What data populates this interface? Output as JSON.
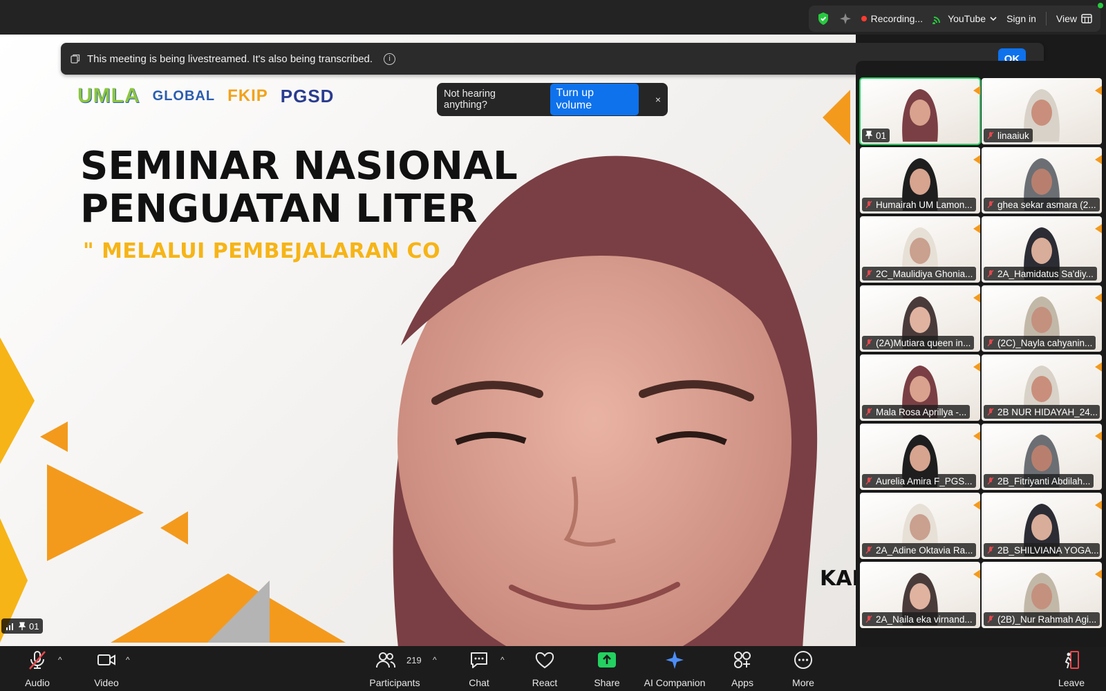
{
  "top_bar": {
    "recording_label": "Recording...",
    "stream_target": "YouTube",
    "sign_in_label": "Sign in",
    "view_label": "View"
  },
  "banner": {
    "text": "This meeting is being livestreamed. It's also being transcribed.",
    "ok_label": "OK"
  },
  "audio_toast": {
    "text": "Not hearing anything?",
    "button_label": "Turn up volume",
    "close_glyph": "×"
  },
  "slide": {
    "title": "SEMINAR NASIONAL\nPENGUATAN LITER",
    "subtitle": "\" MELALUI PEMBEJALARAN CO",
    "date_fragment": "KAN",
    "logos": [
      "UMLA",
      "GLOBAL",
      "FKIP",
      "PGSD"
    ]
  },
  "main_video": {
    "label": "01"
  },
  "gallery": {
    "tiles": [
      {
        "name": "01",
        "pinned": true,
        "active": true
      },
      {
        "name": "linaaiuk",
        "pinned": false,
        "active": false
      },
      {
        "name": "Humairah UM Lamon...",
        "pinned": false,
        "active": false
      },
      {
        "name": "ghea sekar asmara (2...",
        "pinned": false,
        "active": false
      },
      {
        "name": "2C_Maulidiya Ghonia...",
        "pinned": false,
        "active": false
      },
      {
        "name": "2A_Hamidatus Sa'diy...",
        "pinned": false,
        "active": false
      },
      {
        "name": "(2A)Mutiara queen in...",
        "pinned": false,
        "active": false
      },
      {
        "name": "(2C)_Nayla cahyanin...",
        "pinned": false,
        "active": false
      },
      {
        "name": "Mala Rosa Aprillya -...",
        "pinned": false,
        "active": false
      },
      {
        "name": "2B NUR HIDAYAH_24...",
        "pinned": false,
        "active": false
      },
      {
        "name": "Aurelia Amira F_PGS...",
        "pinned": false,
        "active": false
      },
      {
        "name": "2B_Fitriyanti Abdilah...",
        "pinned": false,
        "active": false
      },
      {
        "name": "2A_Adine Oktavia Ra...",
        "pinned": false,
        "active": false
      },
      {
        "name": "2B_SHILVIANA YOGA...",
        "pinned": false,
        "active": false
      },
      {
        "name": "2A_Naila eka virnand...",
        "pinned": false,
        "active": false
      },
      {
        "name": "(2B)_Nur Rahmah Agi...",
        "pinned": false,
        "active": false
      }
    ]
  },
  "toolbar": {
    "audio": "Audio",
    "video": "Video",
    "participants": "Participants",
    "participants_count": "219",
    "chat": "Chat",
    "react": "React",
    "share": "Share",
    "ai_companion": "AI Companion",
    "apps": "Apps",
    "more": "More",
    "leave": "Leave"
  },
  "colors": {
    "accent_blue": "#0e72ed",
    "share_green": "#23d160",
    "record_red": "#ff3b30",
    "slide_orange": "#f39a1d",
    "slide_yellow": "#f6b416"
  },
  "icons": [
    "shield-icon",
    "sparkle-icon",
    "cast-icon",
    "chevron-down-icon",
    "grid-icon",
    "copy-icon",
    "info-icon",
    "close-icon",
    "signal-icon",
    "pin-icon",
    "mic-muted-icon",
    "video-icon",
    "participants-icon",
    "chat-icon",
    "heart-icon",
    "share-arrow-icon",
    "ai-sparkle-icon",
    "apps-icon",
    "more-icon",
    "leave-icon"
  ]
}
